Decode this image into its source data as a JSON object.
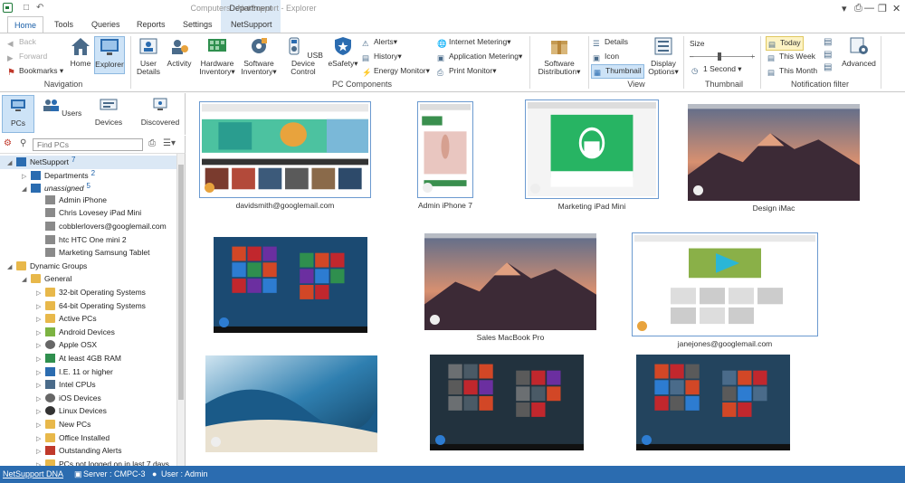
{
  "window": {
    "title": "Computers - NetSupport - Explorer",
    "context_tab_group": "Department"
  },
  "tabs": [
    {
      "label": "Home",
      "active": true
    },
    {
      "label": "Tools"
    },
    {
      "label": "Queries"
    },
    {
      "label": "Reports"
    },
    {
      "label": "Settings"
    },
    {
      "label": "NetSupport"
    }
  ],
  "ribbon": {
    "navigation": {
      "label": "Navigation",
      "back": "Back",
      "forward": "Forward",
      "bookmarks": "Bookmarks",
      "home": "Home",
      "explorer": "Explorer"
    },
    "pc_components": {
      "label": "PC Components",
      "user_details": [
        "User",
        "Details"
      ],
      "activity": "Activity",
      "hardware_inventory": [
        "Hardware",
        "Inventory"
      ],
      "software_inventory": [
        "Software",
        "Inventory"
      ],
      "usb_device_control": [
        "USB Device",
        "Control"
      ],
      "esafety": "eSafety",
      "alerts": "Alerts",
      "history": "History",
      "energy_monitor": "Energy Monitor",
      "internet_metering": "Internet Metering",
      "application_metering": "Application Metering",
      "print_monitor": "Print Monitor"
    },
    "software_distribution": [
      "Software",
      "Distribution"
    ],
    "view": {
      "label": "View",
      "details": "Details",
      "icon": "Icon",
      "thumbnail": "Thumbnail",
      "display_options": [
        "Display",
        "Options"
      ]
    },
    "thumbnail": {
      "label": "Thumbnail",
      "size": "Size",
      "interval": "1 Second"
    },
    "notification_filter": {
      "label": "Notification filter",
      "today": "Today",
      "this_week": "This Week",
      "this_month": "This Month",
      "advanced": "Advanced"
    }
  },
  "left_nav": [
    {
      "label": "PCs",
      "active": true
    },
    {
      "label": "Users"
    },
    {
      "label": "Devices"
    },
    {
      "label": "Discovered"
    }
  ],
  "find": {
    "placeholder": "Find PCs"
  },
  "tree": [
    {
      "label": "NetSupport",
      "count": "7",
      "level": 0,
      "expanded": true,
      "icon": "netsupport-icon",
      "highlight": true
    },
    {
      "label": "Departments",
      "count": "2",
      "level": 1,
      "expanded": false,
      "icon": "departments-icon"
    },
    {
      "label": "unassigned",
      "count": "5",
      "level": 1,
      "expanded": true,
      "icon": "unassigned-icon",
      "italic": true
    },
    {
      "label": "Admin iPhone",
      "level": 2,
      "icon": "device-icon"
    },
    {
      "label": "Chris Lovesey iPad Mini",
      "level": 2,
      "icon": "device-icon"
    },
    {
      "label": "cobblerlovers@googlemail.com",
      "level": 2,
      "icon": "device-icon"
    },
    {
      "label": "htc HTC One mini 2",
      "level": 2,
      "icon": "device-icon"
    },
    {
      "label": "Marketing Samsung Tablet",
      "level": 2,
      "icon": "device-icon"
    },
    {
      "label": "Dynamic Groups",
      "level": 0,
      "expanded": true,
      "icon": "folder-icon"
    },
    {
      "label": "General",
      "level": 1,
      "expanded": true,
      "icon": "folder-icon"
    },
    {
      "label": "32-bit Operating Systems",
      "level": 2,
      "icon": "folder-icon"
    },
    {
      "label": "64-bit Operating Systems",
      "level": 2,
      "icon": "folder-icon"
    },
    {
      "label": "Active PCs",
      "level": 2,
      "icon": "folder-icon"
    },
    {
      "label": "Android Devices",
      "level": 2,
      "icon": "android-icon"
    },
    {
      "label": "Apple OSX",
      "level": 2,
      "icon": "apple-icon"
    },
    {
      "label": "At least 4GB RAM",
      "level": 2,
      "icon": "ram-icon"
    },
    {
      "label": "I.E. 11 or higher",
      "level": 2,
      "icon": "ie-icon"
    },
    {
      "label": "Intel CPUs",
      "level": 2,
      "icon": "cpu-icon"
    },
    {
      "label": "iOS Devices",
      "level": 2,
      "icon": "apple-icon"
    },
    {
      "label": "Linux Devices",
      "level": 2,
      "icon": "linux-icon"
    },
    {
      "label": "New PCs",
      "level": 2,
      "icon": "folder-icon"
    },
    {
      "label": "Office Installed",
      "level": 2,
      "icon": "folder-icon"
    },
    {
      "label": "Outstanding Alerts",
      "level": 2,
      "icon": "alert-icon"
    },
    {
      "label": "PCs not logged on in last 7 days",
      "level": 2,
      "icon": "folder-icon"
    }
  ],
  "thumbnails": [
    {
      "label": "davidsmith@googlemail.com",
      "kind": "browser-green",
      "badge": "chrome-icon",
      "selected": true
    },
    {
      "label": "Admin iPhone 7",
      "kind": "phone",
      "badge": "apple-icon",
      "selected": true
    },
    {
      "label": "Marketing iPad Mini",
      "kind": "tablet-green",
      "badge": "apple-icon",
      "selected": true
    },
    {
      "label": "Design iMac",
      "kind": "mac-mountain",
      "badge": "apple-icon"
    },
    {
      "label": "",
      "kind": "win-blue",
      "badge": "windows-icon"
    },
    {
      "label": "Sales MacBook Pro",
      "kind": "mac-mountain",
      "badge": "apple-icon"
    },
    {
      "label": "janejones@googlemail.com",
      "kind": "browser-game",
      "badge": "chrome-icon",
      "selected": true
    },
    {
      "label": "",
      "kind": "mac-wave",
      "badge": "apple-icon"
    },
    {
      "label": "",
      "kind": "win-dark",
      "badge": "windows-icon"
    },
    {
      "label": "",
      "kind": "win-lake",
      "badge": "windows-icon"
    }
  ],
  "status": {
    "product": "NetSupport DNA",
    "server": "Server : CMPC-3",
    "user": "User : Admin"
  },
  "colors": {
    "accent": "#2b6cb0",
    "selection": "#cde3f7",
    "win_tile_orange": "#d24726",
    "win_tile_red": "#c1272d",
    "win_tile_purple": "#6b2fa0",
    "win_tile_blue": "#2d7cd1"
  }
}
